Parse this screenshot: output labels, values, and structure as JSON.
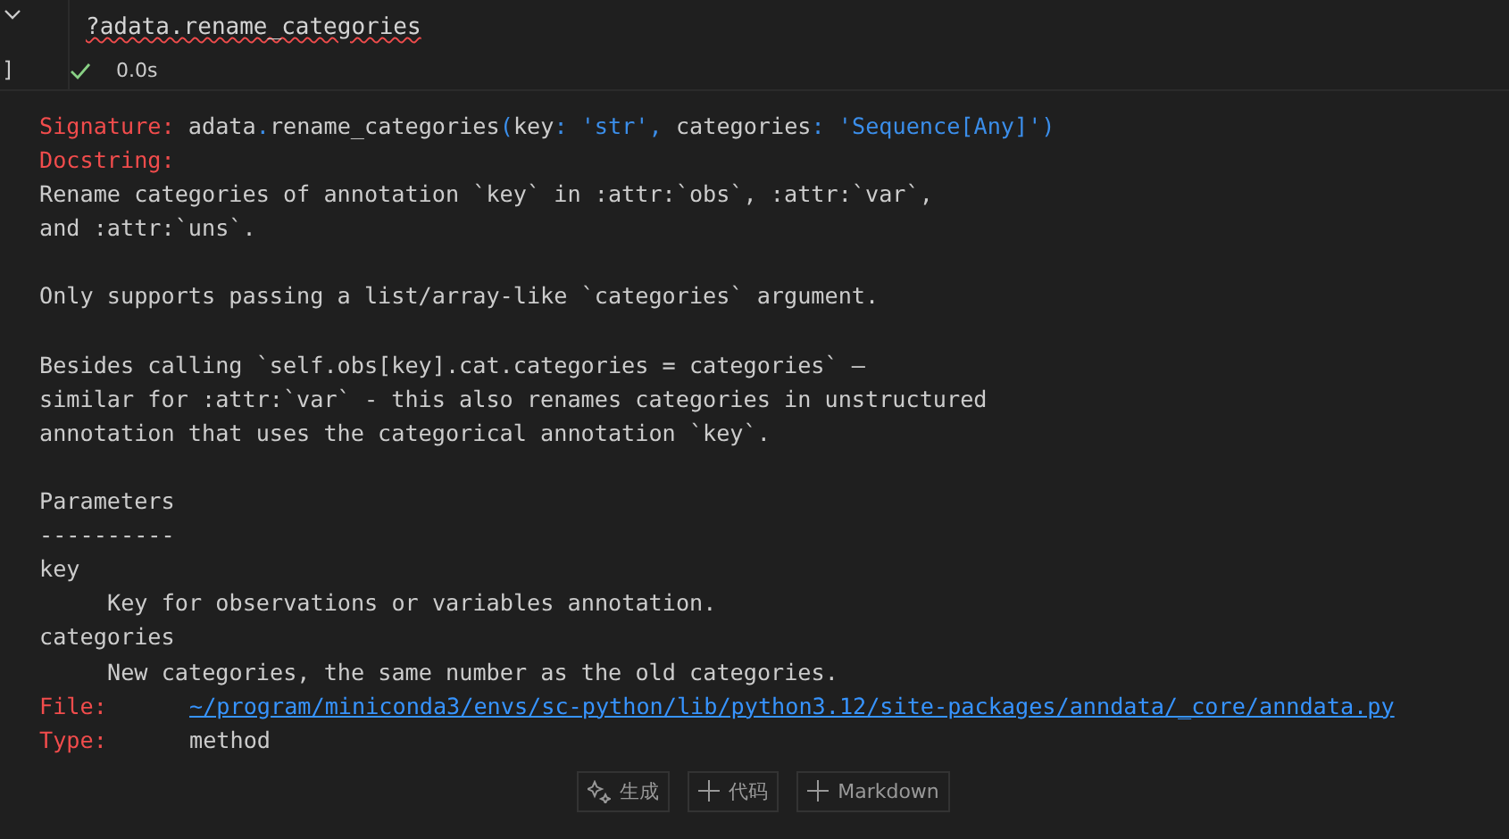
{
  "cell": {
    "execution_count": "]",
    "code": "?adata.rename_categories",
    "status": {
      "ok": true,
      "duration": "0.0s"
    }
  },
  "output": {
    "signature_label": "Signature:",
    "signature": [
      {
        "kind": "name",
        "text": "adata"
      },
      {
        "kind": "punct",
        "text": "."
      },
      {
        "kind": "name",
        "text": "rename_categories"
      },
      {
        "kind": "punct",
        "text": "("
      },
      {
        "kind": "name",
        "text": "key"
      },
      {
        "kind": "punct",
        "text": ": 'str',"
      },
      {
        "kind": "name",
        "text": " categories"
      },
      {
        "kind": "punct",
        "text": ": 'Sequence[Any]')"
      }
    ],
    "docstring_label": "Docstring:",
    "paragraphs": [
      [
        "Rename categories of annotation `key` in :attr:`obs`, :attr:`var`,",
        "and :attr:`uns`."
      ],
      [
        "Only supports passing a list/array-like `categories` argument."
      ],
      [
        "Besides calling `self.obs[key].cat.categories = categories` –",
        "similar for :attr:`var` - this also renames categories in unstructured",
        "annotation that uses the categorical annotation `key`."
      ],
      [
        "Parameters",
        "----------"
      ]
    ],
    "parameters": [
      {
        "name": "key",
        "description": "Key for observations or variables annotation."
      },
      {
        "name": "categories",
        "description": "New categories, the same number as the old categories."
      }
    ],
    "file_label": "File:",
    "file": "~/program/miniconda3/envs/sc-python/lib/python3.12/site-packages/anndata/_core/anndata.py",
    "type_label": "Type:",
    "type": "method"
  },
  "toolbar": [
    {
      "kind": "sparkle",
      "label": "生成"
    },
    {
      "kind": "plus",
      "label": "代码"
    },
    {
      "kind": "plus",
      "label": "Markdown"
    }
  ]
}
